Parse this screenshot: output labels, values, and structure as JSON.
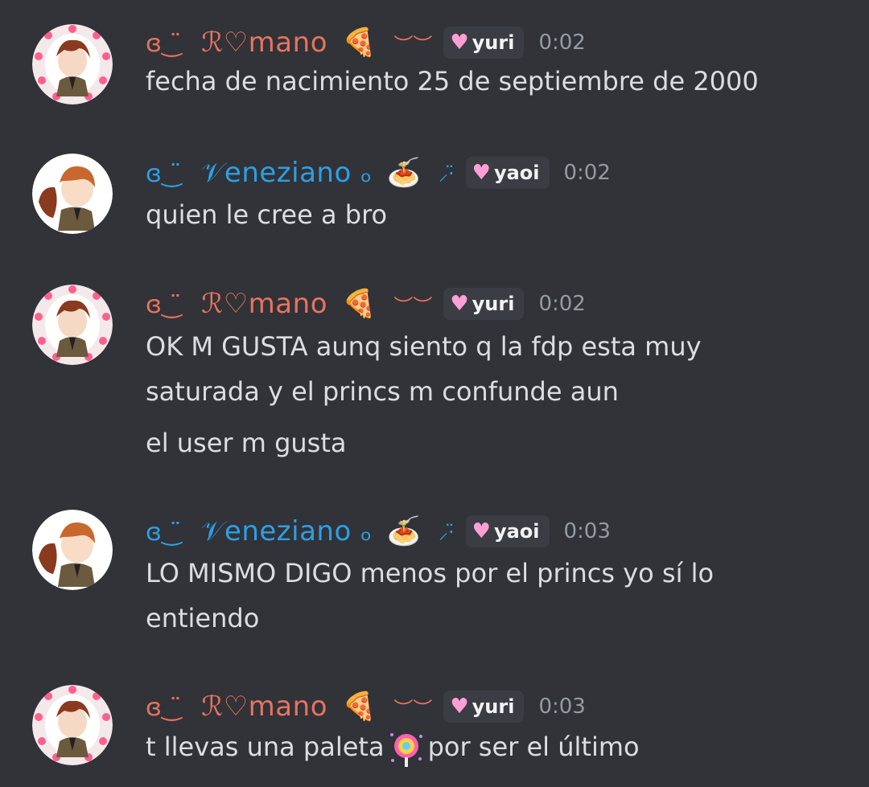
{
  "messages": [
    {
      "user": "Romano",
      "name_text": "ℛ♡mano",
      "name_prefix": "ɞ‿̈ ",
      "emoji": "🍕",
      "tail": "︶︶",
      "tag": "yuri",
      "time": "0:02",
      "lines": [
        "fecha de nacimiento 25 de septiembre de 2000"
      ]
    },
    {
      "user": "Veneziano",
      "name_text": "𝒱eneziano ₒ",
      "name_prefix": "ɞ‿̈ ",
      "emoji": "🍝",
      "tail": "⸝⋅̈",
      "tag": "yaoi",
      "time": "0:02",
      "lines": [
        "quien le cree a bro"
      ]
    },
    {
      "user": "Romano",
      "name_text": "ℛ♡mano",
      "name_prefix": "ɞ‿̈ ",
      "emoji": "🍕",
      "tail": "︶︶",
      "tag": "yuri",
      "time": "0:02",
      "lines": [
        "OK M GUSTA aunq siento q la fdp esta muy",
        "saturada y el princs m confunde aun",
        "el user m gusta"
      ]
    },
    {
      "user": "Veneziano",
      "name_text": "𝒱eneziano ₒ",
      "name_prefix": "ɞ‿̈ ",
      "emoji": "🍝",
      "tail": "⸝⋅̈",
      "tag": "yaoi",
      "time": "0:03",
      "lines": [
        "LO MISMO DIGO menos por el princs yo sí lo",
        "entiendo"
      ]
    },
    {
      "user": "Romano",
      "name_text": "ℛ♡mano",
      "name_prefix": "ɞ‿̈ ",
      "emoji": "🍕",
      "tail": "︶︶",
      "tag": "yuri",
      "time": "0:03",
      "lines_split": {
        "before": "t llevas una paleta",
        "after": "por ser el último"
      }
    }
  ],
  "colors": {
    "background": "#313338",
    "romano": "#e8735e",
    "veneziano": "#2d9fe6",
    "tag_bg": "#3b3d44"
  },
  "icons": {
    "avatar_romano": "avatar-romano-heart-frame",
    "avatar_veneziano": "avatar-veneziano",
    "lollipop": "lollipop-icon"
  }
}
